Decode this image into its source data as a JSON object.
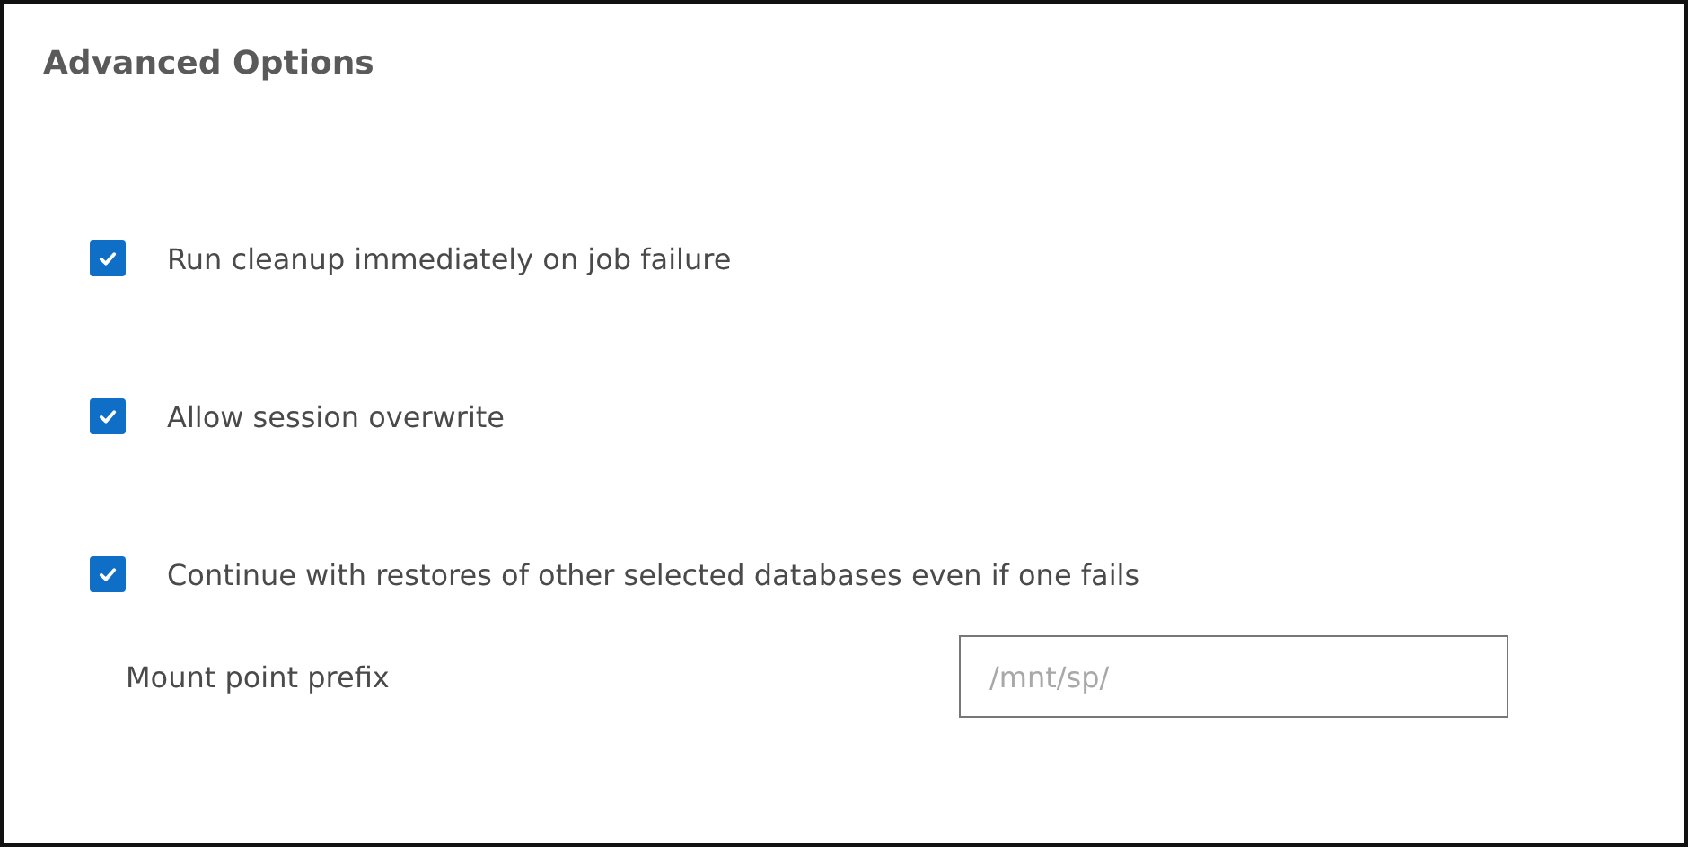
{
  "title": "Advanced Options",
  "options": [
    {
      "label": "Run cleanup immediately on job failure",
      "checked": true
    },
    {
      "label": "Allow session overwrite",
      "checked": true
    },
    {
      "label": "Continue with restores of other selected databases even if one fails",
      "checked": true
    }
  ],
  "mount_point": {
    "label": "Mount point prefix",
    "placeholder": "/mnt/sp/"
  }
}
